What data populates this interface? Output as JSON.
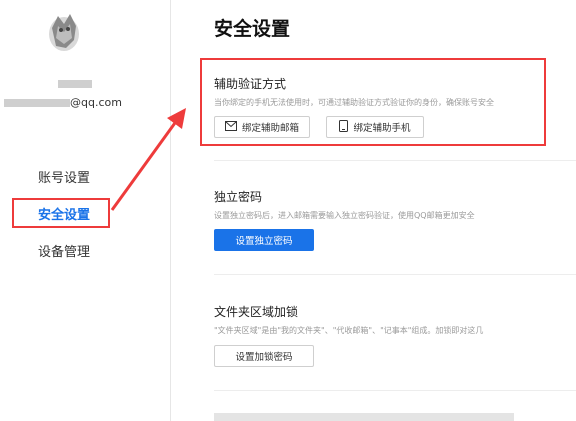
{
  "sidebar": {
    "email_suffix": "@qq.com",
    "items": [
      {
        "label": "账号设置"
      },
      {
        "label": "安全设置"
      },
      {
        "label": "设备管理"
      }
    ]
  },
  "main": {
    "title": "安全设置",
    "sections": [
      {
        "title": "辅助验证方式",
        "desc": "当你绑定的手机无法使用时，可通过辅助验证方式验证你的身份，确保账号安全",
        "buttons": [
          "绑定辅助邮箱",
          "绑定辅助手机"
        ]
      },
      {
        "title": "独立密码",
        "desc": "设置独立密码后，进入邮箱需要输入独立密码验证，使用QQ邮箱更加安全",
        "buttons": [
          "设置独立密码"
        ]
      },
      {
        "title": "文件夹区域加锁",
        "desc": "\"文件夹区域\"是由\"我的文件夹\"、\"代收邮箱\"、\"记事本\"组成。加锁即对这几",
        "buttons": [
          "设置加锁密码"
        ]
      }
    ]
  },
  "colors": {
    "accent": "#1a73e8",
    "highlight": "#ee3b3b"
  }
}
